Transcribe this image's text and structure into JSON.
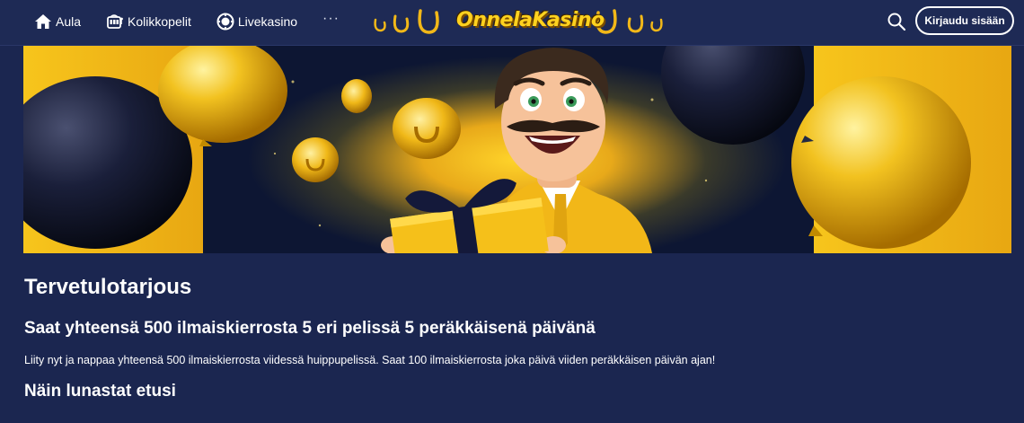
{
  "nav": {
    "items": [
      {
        "label": "Aula",
        "icon": "home-icon"
      },
      {
        "label": "Kolikkopelit",
        "icon": "slot-machine-icon"
      },
      {
        "label": "Livekasino",
        "icon": "casino-chip-icon"
      }
    ],
    "more_label": "···",
    "more_icon": "more-icon"
  },
  "logo": {
    "text": "OnnelaKasino"
  },
  "header": {
    "search_icon": "search-icon",
    "login_label": "Kirjaudu sisään"
  },
  "main": {
    "title": "Tervetulotarjous",
    "subtitle": "Saat yhteensä 500 ilmaiskierrosta 5 eri pelissä 5 peräkkäisenä päivänä",
    "description": "Liity nyt ja nappaa yhteensä 500 ilmaiskierrosta viidessä huippupelissä. Saat 100 ilmaiskierrosta joka päivä viiden peräkkäisen päivän ajan!",
    "section_heading": "Näin lunastat etusi"
  },
  "colors": {
    "background": "#1b2650",
    "topbar": "#1e2a55",
    "gold": "#ffd21f",
    "hero_bg": "#0d1633"
  }
}
